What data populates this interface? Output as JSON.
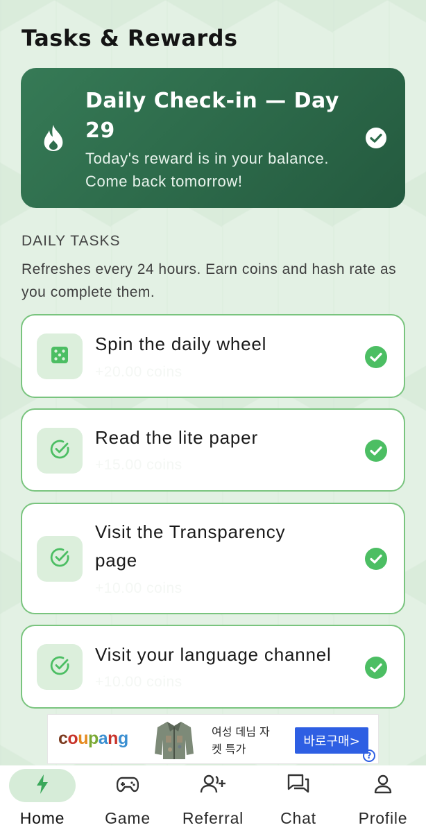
{
  "header": {
    "title": "Tasks & Rewards"
  },
  "checkin": {
    "title": "Daily Check-in — Day 29",
    "subtitle": "Today's reward is in your balance. Come back tomorrow!",
    "icon": "flame-icon",
    "status_icon": "check-circle-icon"
  },
  "daily_tasks": {
    "heading": "DAILY TASKS",
    "description": "Refreshes every 24 hours. Earn coins and hash rate as you complete them.",
    "items": [
      {
        "label": "Spin the daily wheel",
        "reward": "+20.00 coins",
        "icon": "dice-icon",
        "completed": true
      },
      {
        "label": "Read the lite paper",
        "reward": "+15.00 coins",
        "icon": "check-circle-outline-icon",
        "completed": true
      },
      {
        "label": "Visit the Transparency page",
        "reward": "+10.00 coins",
        "icon": "check-circle-outline-icon",
        "completed": true
      },
      {
        "label": "Visit your language channel",
        "reward": "+10.00 coins",
        "icon": "check-circle-outline-icon",
        "completed": true
      }
    ]
  },
  "ad": {
    "brand": "coupang",
    "text": "여성 데님 자켓 특가",
    "cta": "바로구매>",
    "info": "?"
  },
  "bottom_nav": {
    "items": [
      {
        "label": "Home",
        "icon": "bolt-icon",
        "active": true
      },
      {
        "label": "Game",
        "icon": "gamepad-icon",
        "active": false
      },
      {
        "label": "Referral",
        "icon": "add-user-icon",
        "active": false
      },
      {
        "label": "Chat",
        "icon": "chat-icon",
        "active": false
      },
      {
        "label": "Profile",
        "icon": "user-icon",
        "active": false
      }
    ]
  },
  "colors": {
    "background": "#e3f1e4",
    "card_green": "#2f6f4e",
    "accent_green": "#4cbe63",
    "task_border": "#79c47e",
    "ad_cta": "#2e5fe3"
  }
}
